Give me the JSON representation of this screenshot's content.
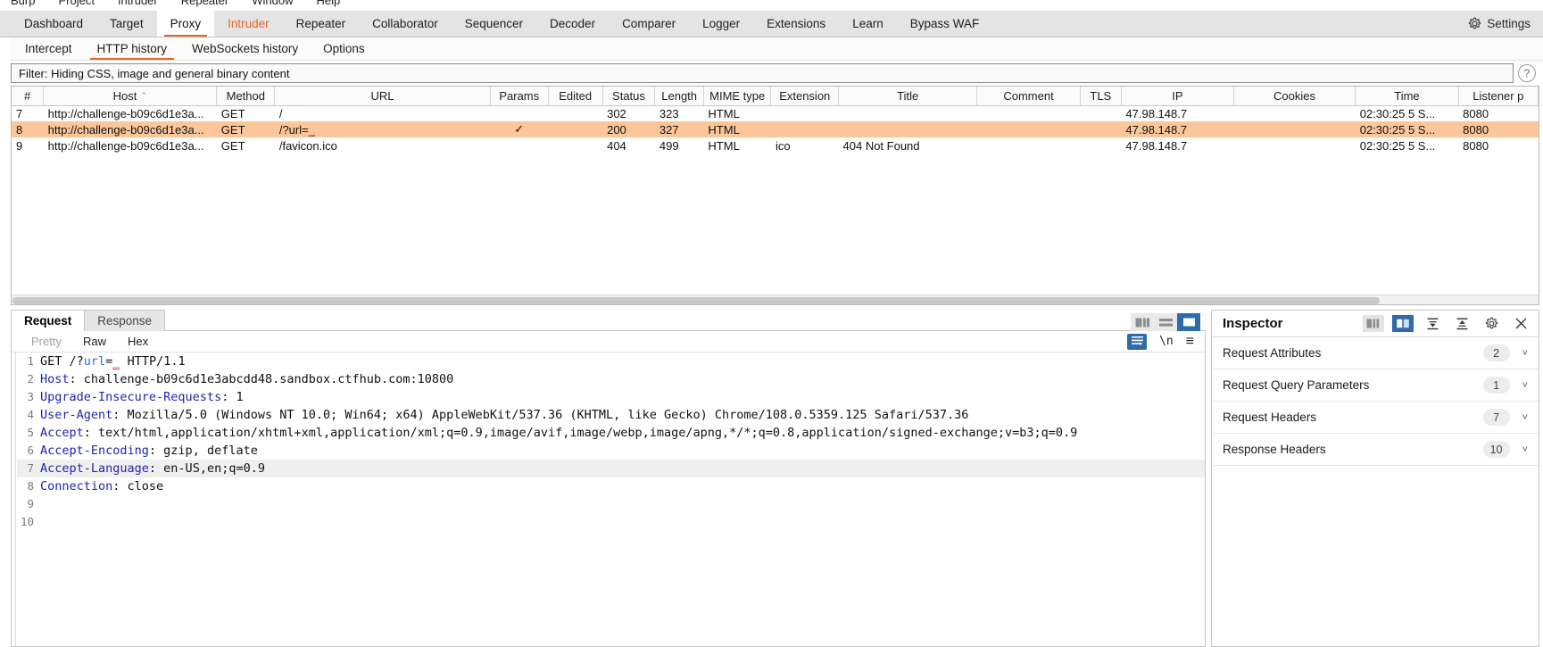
{
  "window": {
    "menu_items": [
      "Burp",
      "Project",
      "Intruder",
      "Repeater",
      "Window",
      "Help"
    ],
    "settings_label": "Settings",
    "settings_icon": "gear-icon"
  },
  "main_tabs": [
    {
      "label": "Dashboard",
      "active": false,
      "alerted": false
    },
    {
      "label": "Target",
      "active": false,
      "alerted": false
    },
    {
      "label": "Proxy",
      "active": true,
      "alerted": false
    },
    {
      "label": "Intruder",
      "active": false,
      "alerted": true
    },
    {
      "label": "Repeater",
      "active": false,
      "alerted": false
    },
    {
      "label": "Collaborator",
      "active": false,
      "alerted": false
    },
    {
      "label": "Sequencer",
      "active": false,
      "alerted": false
    },
    {
      "label": "Decoder",
      "active": false,
      "alerted": false
    },
    {
      "label": "Comparer",
      "active": false,
      "alerted": false
    },
    {
      "label": "Logger",
      "active": false,
      "alerted": false
    },
    {
      "label": "Extensions",
      "active": false,
      "alerted": false
    },
    {
      "label": "Learn",
      "active": false,
      "alerted": false
    },
    {
      "label": "Bypass WAF",
      "active": false,
      "alerted": false
    }
  ],
  "sub_tabs": [
    {
      "label": "Intercept",
      "active": false
    },
    {
      "label": "HTTP history",
      "active": true
    },
    {
      "label": "WebSockets history",
      "active": false
    },
    {
      "label": "Options",
      "active": false
    }
  ],
  "filter": {
    "text": "Filter: Hiding CSS, image and general binary content",
    "help_icon": "question-mark-icon"
  },
  "history_table": {
    "columns": [
      "#",
      "Host",
      "Method",
      "URL",
      "Params",
      "Edited",
      "Status",
      "Length",
      "MIME type",
      "Extension",
      "Title",
      "Comment",
      "TLS",
      "IP",
      "Cookies",
      "Time",
      "Listener p"
    ],
    "sorted_column": "Host",
    "sort_caret": "⌃",
    "rows": [
      {
        "num": "7",
        "host": "http://challenge-b09c6d1e3a...",
        "method": "GET",
        "url": "/",
        "params": "",
        "edited": "",
        "status": "302",
        "length": "323",
        "mime": "HTML",
        "extension": "",
        "title": "",
        "comment": "",
        "tls": "",
        "ip": "47.98.148.7",
        "cookies": "",
        "time": "02:30:25 5 S...",
        "listener": "8080",
        "selected": false
      },
      {
        "num": "8",
        "host": "http://challenge-b09c6d1e3a...",
        "method": "GET",
        "url": "/?url=_",
        "params": "✓",
        "edited": "",
        "status": "200",
        "length": "327",
        "mime": "HTML",
        "extension": "",
        "title": "",
        "comment": "",
        "tls": "",
        "ip": "47.98.148.7",
        "cookies": "",
        "time": "02:30:25 5 S...",
        "listener": "8080",
        "selected": true
      },
      {
        "num": "9",
        "host": "http://challenge-b09c6d1e3a...",
        "method": "GET",
        "url": "/favicon.ico",
        "params": "",
        "edited": "",
        "status": "404",
        "length": "499",
        "mime": "HTML",
        "extension": "ico",
        "title": "404 Not Found",
        "comment": "",
        "tls": "",
        "ip": "47.98.148.7",
        "cookies": "",
        "time": "02:30:25 5 S...",
        "listener": "8080",
        "selected": false
      }
    ]
  },
  "message_panel": {
    "tabs": [
      {
        "label": "Request",
        "active": true
      },
      {
        "label": "Response",
        "active": false
      }
    ],
    "layout_buttons": [
      {
        "name": "split-vertical-icon",
        "active": false
      },
      {
        "name": "split-horizontal-icon",
        "active": false
      },
      {
        "name": "single-pane-icon",
        "active": true
      }
    ],
    "formats": [
      {
        "label": "Pretty",
        "active": false,
        "dim": true
      },
      {
        "label": "Raw",
        "active": true,
        "dim": false
      },
      {
        "label": "Hex",
        "active": false,
        "dim": false
      }
    ],
    "editor_icons": [
      {
        "name": "word-wrap-icon",
        "glyph": "",
        "active": true
      },
      {
        "name": "show-newlines-icon",
        "glyph": "\\n",
        "active": false
      },
      {
        "name": "editor-menu-icon",
        "glyph": "≡",
        "active": false
      }
    ]
  },
  "request": {
    "lines": [
      {
        "n": "1",
        "parts": [
          {
            "t": "GET /?",
            "c": "plain"
          },
          {
            "t": "url",
            "c": "param"
          },
          {
            "t": "=",
            "c": "plain"
          },
          {
            "t": "_",
            "c": "pval"
          },
          {
            "t": " HTTP/1.1",
            "c": "plain"
          }
        ],
        "highlight": false
      },
      {
        "n": "2",
        "parts": [
          {
            "t": "Host",
            "c": "hk"
          },
          {
            "t": ": challenge-b09c6d1e3abcdd48.sandbox.ctfhub.com:10800",
            "c": "plain"
          }
        ],
        "highlight": false
      },
      {
        "n": "3",
        "parts": [
          {
            "t": "Upgrade-Insecure-Requests",
            "c": "hk"
          },
          {
            "t": ": 1",
            "c": "plain"
          }
        ],
        "highlight": false
      },
      {
        "n": "4",
        "parts": [
          {
            "t": "User-Agent",
            "c": "hk"
          },
          {
            "t": ": Mozilla/5.0 (Windows NT 10.0; Win64; x64) AppleWebKit/537.36 (KHTML, like Gecko) Chrome/108.0.5359.125 Safari/537.36",
            "c": "plain"
          }
        ],
        "highlight": false
      },
      {
        "n": "5",
        "parts": [
          {
            "t": "Accept",
            "c": "hk"
          },
          {
            "t": ": text/html,application/xhtml+xml,application/xml;q=0.9,image/avif,image/webp,image/apng,*/*;q=0.8,application/signed-exchange;v=b3;q=0.9",
            "c": "plain"
          }
        ],
        "highlight": false
      },
      {
        "n": "6",
        "parts": [
          {
            "t": "Accept-Encoding",
            "c": "hk"
          },
          {
            "t": ": gzip, deflate",
            "c": "plain"
          }
        ],
        "highlight": false
      },
      {
        "n": "7",
        "parts": [
          {
            "t": "Accept-Language",
            "c": "hk"
          },
          {
            "t": ": en-US,en;q=0.9",
            "c": "plain"
          }
        ],
        "highlight": true
      },
      {
        "n": "8",
        "parts": [
          {
            "t": "Connection",
            "c": "hk"
          },
          {
            "t": ": close",
            "c": "plain"
          }
        ],
        "highlight": false
      },
      {
        "n": "9",
        "parts": [
          {
            "t": "",
            "c": "plain"
          }
        ],
        "highlight": false
      },
      {
        "n": "10",
        "parts": [
          {
            "t": "",
            "c": "plain"
          }
        ],
        "highlight": false
      }
    ]
  },
  "inspector": {
    "title": "Inspector",
    "header_icons": [
      {
        "name": "inspector-dock-left-icon",
        "active": false
      },
      {
        "name": "inspector-dock-right-icon",
        "active": true
      },
      {
        "name": "collapse-all-icon",
        "active": false
      },
      {
        "name": "expand-all-icon",
        "active": false
      },
      {
        "name": "inspector-settings-gear-icon",
        "active": false
      },
      {
        "name": "inspector-close-icon",
        "active": false
      }
    ],
    "sections": [
      {
        "label": "Request Attributes",
        "count": "2"
      },
      {
        "label": "Request Query Parameters",
        "count": "1"
      },
      {
        "label": "Request Headers",
        "count": "7"
      },
      {
        "label": "Response Headers",
        "count": "10"
      }
    ],
    "chevron": "˅"
  },
  "colors": {
    "accent_orange": "#e8662a",
    "selection_orange": "#fbc79a",
    "accent_blue": "#2d6ca8",
    "header_key_blue": "#2222b0",
    "param_blue": "#2f6fd0",
    "param_value_red": "#d03030"
  }
}
